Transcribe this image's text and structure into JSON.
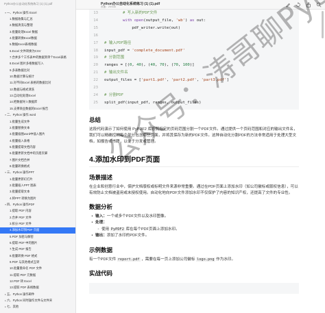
{
  "sidebar": {
    "header": "Python办公自动化系统练习 (1) (1).pdf",
    "items": [
      {
        "label": "一、Python 操作 Excel",
        "level": 1,
        "caret": "▾"
      },
      {
        "label": "1.数据收集与汇总",
        "level": 2
      },
      {
        "label": "2.数据清洗与整理",
        "level": 2
      },
      {
        "label": "3.批量处理Excel 数据",
        "level": 2
      },
      {
        "label": "4.批量转换Excel数据",
        "level": 2
      },
      {
        "label": "5.数据Excel表格数据",
        "level": 2
      },
      {
        "label": "6.Excel 文件转换为CSV",
        "level": 2
      },
      {
        "label": "7.合并多个工作表中的数据到单个Excel表格",
        "level": 2
      },
      {
        "label": "8.Excel 图片多格数据写入",
        "level": 2
      },
      {
        "label": "9.多表数据比对",
        "level": 2
      },
      {
        "label": "10.数据计算与统计",
        "level": 2
      },
      {
        "label": "11.对不同Excel 表格的数据比对",
        "level": 2
      },
      {
        "label": "12.数据与格式清洗",
        "level": 2
      },
      {
        "label": "13.自动化处理Excel",
        "level": 2
      },
      {
        "label": "14.把数据导入数据库",
        "level": 2
      },
      {
        "label": "15.支撑商业数据的Excel 报告",
        "level": 2
      },
      {
        "label": "二、Python 操作 word",
        "level": 1,
        "caret": "▾"
      },
      {
        "label": "1.批量生成文件",
        "level": 2
      },
      {
        "label": "2.批量替换文本",
        "level": 2
      },
      {
        "label": "3.批量插图word中插入图片",
        "level": 2
      },
      {
        "label": "4.批量插入表格",
        "level": 2
      },
      {
        "label": "5.批量提取文档内容",
        "level": 2
      },
      {
        "label": "6.批量更新文档中的页眉页脚",
        "level": 2
      },
      {
        "label": "7.图片文档合并",
        "level": 2
      },
      {
        "label": "8.批量转换格式",
        "level": 2
      },
      {
        "label": "三、Python 操作PPT",
        "level": 1,
        "caret": "▾"
      },
      {
        "label": "1.批量更新幻灯片",
        "level": 2
      },
      {
        "label": "2.批量插入PPT 图表",
        "level": 2
      },
      {
        "label": "3.批量提取文本",
        "level": 2
      },
      {
        "label": "4.将PPT 转换为图片",
        "level": 2
      },
      {
        "label": "四、Python 操作PDF",
        "level": 1,
        "caret": "▾"
      },
      {
        "label": "1.提取 PDF 内容",
        "level": 2
      },
      {
        "label": "2.合并 PDF 文件",
        "level": 2
      },
      {
        "label": "3.拆分 PDF 文件",
        "level": 2
      },
      {
        "label": "4.添加水印到PDF 页面",
        "level": 2,
        "active": true
      },
      {
        "label": "5.PDF 加密与解密",
        "level": 2
      },
      {
        "label": "6.提取 PDF 中的图片",
        "level": 2
      },
      {
        "label": "7.生成 PDF 报告",
        "level": 2
      },
      {
        "label": "8.批量转换 PDF 格式",
        "level": 2
      },
      {
        "label": "9.PDF 与其他格式互转",
        "level": 2
      },
      {
        "label": "10.批量重命名 PDF 文件",
        "level": 2
      },
      {
        "label": "11.提取 PDF 元数据",
        "level": 2
      },
      {
        "label": "12.PDF 转 Excel",
        "level": 2
      },
      {
        "label": "13.提取 PDF 表格数据",
        "level": 2
      },
      {
        "label": "五、Python 操作邮件",
        "level": 1,
        "caret": "▸"
      },
      {
        "label": "六、Python 同时操作文件与文件夹",
        "level": 1,
        "caret": "▸"
      },
      {
        "label": "七、其他",
        "level": 1,
        "caret": "▸"
      }
    ]
  },
  "titlebar": {
    "title": "Python办公自动化系统练习 (1) (1).pdf",
    "subtitle": "页面：29/438"
  },
  "colors": {
    "accent": "#3478f6",
    "sidebar_bg": "#f4f4f5",
    "code_bg": "#f5f6f7"
  },
  "code_lines": [
    {
      "n": "13",
      "parts": [
        {
          "t": "        # 写入新的PDF文件",
          "c": "cm"
        }
      ]
    },
    {
      "n": "14",
      "parts": [
        {
          "t": "        ",
          "c": ""
        },
        {
          "t": "with",
          "c": "kw"
        },
        {
          "t": " ",
          "c": ""
        },
        {
          "t": "open",
          "c": "kw"
        },
        {
          "t": "(output_file, ",
          "c": ""
        },
        {
          "t": "'wb'",
          "c": "str"
        },
        {
          "t": ") ",
          "c": ""
        },
        {
          "t": "as",
          "c": "kw"
        },
        {
          "t": " out:",
          "c": ""
        }
      ]
    },
    {
      "n": "15",
      "parts": [
        {
          "t": "            pdf_writer.write(out)",
          "c": ""
        }
      ]
    },
    {
      "n": "16",
      "parts": [
        {
          "t": "",
          "c": ""
        }
      ]
    },
    {
      "n": "17",
      "parts": [
        {
          "t": "# 输入PDF路径",
          "c": "cm"
        }
      ]
    },
    {
      "n": "18",
      "parts": [
        {
          "t": "input_pdf = ",
          "c": ""
        },
        {
          "t": "'complete_document.pdf'",
          "c": "str"
        }
      ]
    },
    {
      "n": "19",
      "parts": [
        {
          "t": "# 分割范围",
          "c": "cm"
        }
      ]
    },
    {
      "n": "20",
      "parts": [
        {
          "t": "ranges = [(",
          "c": ""
        },
        {
          "t": "0",
          "c": "num"
        },
        {
          "t": ", ",
          "c": ""
        },
        {
          "t": "40",
          "c": "num"
        },
        {
          "t": "), (",
          "c": ""
        },
        {
          "t": "40",
          "c": "num"
        },
        {
          "t": ", ",
          "c": ""
        },
        {
          "t": "70",
          "c": "num"
        },
        {
          "t": "), (",
          "c": ""
        },
        {
          "t": "70",
          "c": "num"
        },
        {
          "t": ", ",
          "c": ""
        },
        {
          "t": "100",
          "c": "num"
        },
        {
          "t": ")]",
          "c": ""
        }
      ]
    },
    {
      "n": "21",
      "parts": [
        {
          "t": "# 输出文件名",
          "c": "cm"
        }
      ]
    },
    {
      "n": "22",
      "parts": [
        {
          "t": "output_files = [",
          "c": ""
        },
        {
          "t": "'part1.pdf'",
          "c": "str"
        },
        {
          "t": ", ",
          "c": ""
        },
        {
          "t": "'part2.pdf'",
          "c": "str"
        },
        {
          "t": ", ",
          "c": ""
        },
        {
          "t": "'part3.pdf'",
          "c": "str"
        },
        {
          "t": "]",
          "c": ""
        }
      ]
    },
    {
      "n": "23",
      "parts": [
        {
          "t": "",
          "c": ""
        }
      ]
    },
    {
      "n": "24",
      "parts": [
        {
          "t": "# 分割PDF",
          "c": "cm"
        }
      ]
    },
    {
      "n": "25",
      "parts": [
        {
          "t": "split_pdf(input_pdf, ranges, output_files)",
          "c": ""
        }
      ]
    }
  ],
  "doc": {
    "summary_heading": "总结",
    "summary_text": "这段代码演示了如何使用 PyPDF2 库按照指定的页码范围分割一个PDF文件。通过提供一个页码范围和对应的输出文件名，我们可以精确控制每个部分包含哪些页面，并将其保存为新的PDF文件。这种自动化分割PDF的方法非常适用于处理大型文档，如报告或书籍，以便于分发或管理。",
    "section_heading": "4.添加水印到PDF页面",
    "scene_heading": "场景描述",
    "scene_text": "在企业和创意行业中，保护文档版权或标明文件来源非常重要。通过在PDF页面上添加水印（如公司徽标或版权信息），可以有效防止文档被盗用或未授权使用。自动化地向PDF文件添加水印不仅保护了内容的知识产权，还提高了文件的专业性。",
    "analysis_heading": "数据分析",
    "input_label": "输入：",
    "input_text": "一个或多个PDF文件以及水印图像。",
    "process_label": "处理：",
    "process_pre": "使用 ",
    "process_code": "PyPDF2",
    "process_post": " 库在每个PDF页面上添加水印。",
    "output_label": "输出：",
    "output_text": "添加了水印的PDF文件。",
    "example_heading": "示例数据",
    "example_pre": "有一个PDF文件 ",
    "example_code1": "report.pdf",
    "example_mid": " ，需要在每一页上添加公司徽标 ",
    "example_code2": "logo.png",
    "example_post": " 作为水印。",
    "code_heading": "实战代码"
  },
  "watermark": "公众号：涛哥聊Python"
}
